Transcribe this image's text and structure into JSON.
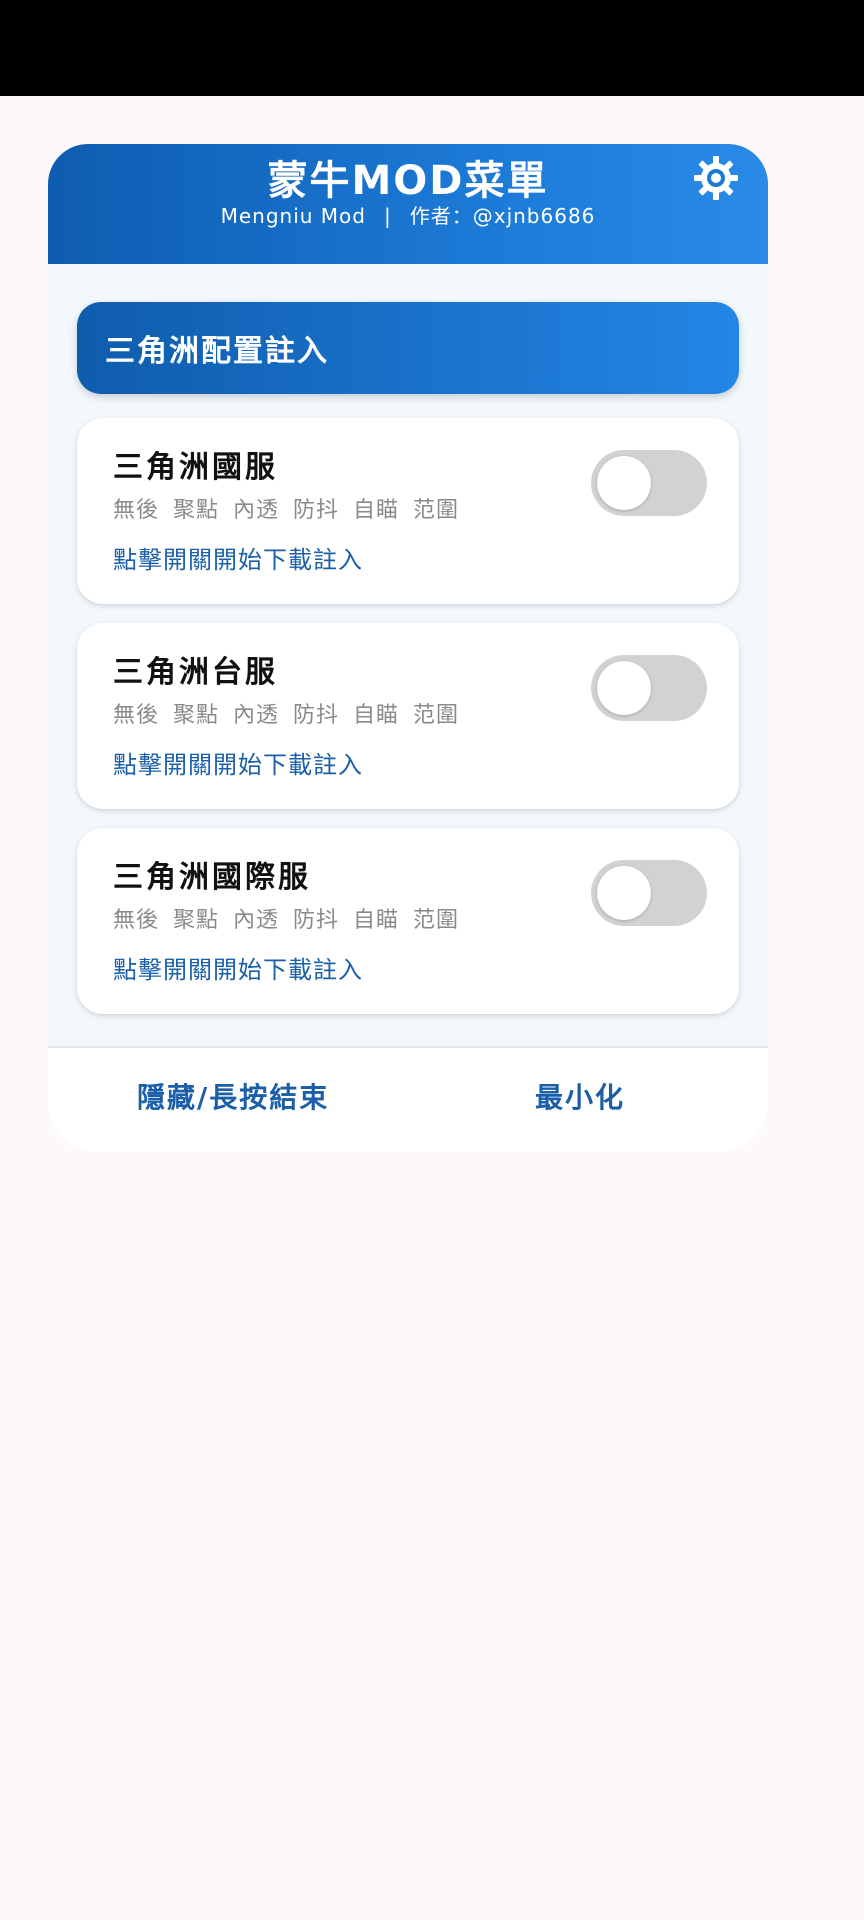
{
  "header": {
    "title": "蒙牛MOD菜單",
    "subtitle_app": "Mengniu Mod",
    "subtitle_sep": "|",
    "subtitle_author": "作者：@xjnb6686",
    "settings_icon": "gear-icon"
  },
  "section": {
    "title": "三角洲配置註入"
  },
  "cards": [
    {
      "title": "三角洲國服",
      "desc": "無後 聚點 內透 防抖 自瞄 范圍",
      "link": "點擊開關開始下載註入",
      "toggle_on": false
    },
    {
      "title": "三角洲台服",
      "desc": "無後 聚點 內透 防抖 自瞄 范圍",
      "link": "點擊開關開始下載註入",
      "toggle_on": false
    },
    {
      "title": "三角洲國際服",
      "desc": "無後 聚點 內透 防抖 自瞄 范圍",
      "link": "點擊開關開始下載註入",
      "toggle_on": false
    }
  ],
  "footer": {
    "hide_label": "隱藏/長按結束",
    "minimize_label": "最小化"
  },
  "colors": {
    "accent": "#1a73cc",
    "link": "#1a5fa8",
    "toggle_off": "#d2d2d2"
  }
}
